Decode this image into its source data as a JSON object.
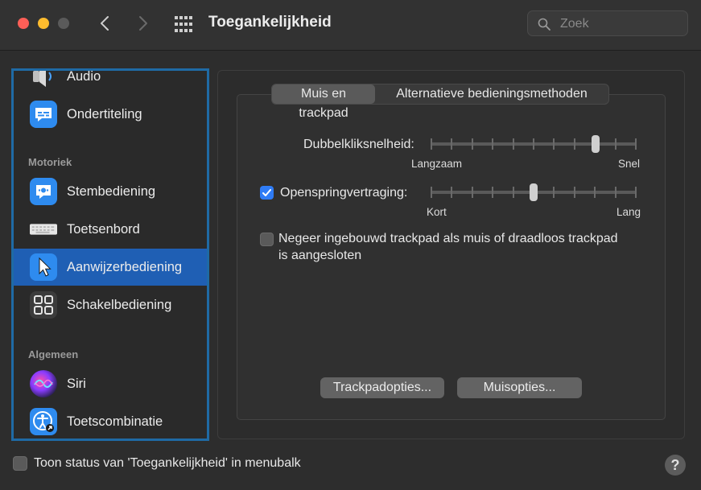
{
  "window": {
    "title": "Toegankelijkheid"
  },
  "search": {
    "placeholder": "Zoek",
    "value": ""
  },
  "sidebar": {
    "items": [
      {
        "label": "Audio",
        "icon": "audio-icon"
      },
      {
        "label": "Ondertiteling",
        "icon": "captions-icon"
      },
      {
        "label": "Stembediening",
        "icon": "voice-control-icon"
      },
      {
        "label": "Toetsenbord",
        "icon": "keyboard-icon"
      },
      {
        "label": "Aanwijzerbediening",
        "icon": "pointer-icon",
        "selected": true
      },
      {
        "label": "Schakelbediening",
        "icon": "switch-control-icon"
      },
      {
        "label": "Siri",
        "icon": "siri-icon"
      },
      {
        "label": "Toetscombinatie",
        "icon": "accessibility-shortcut-icon"
      }
    ],
    "sections": {
      "motor": "Motoriek",
      "general": "Algemeen"
    }
  },
  "tabs": {
    "tab1": "Muis en trackpad",
    "tab2": "Alternatieve bedieningsmethoden",
    "active": "Muis en trackpad"
  },
  "settings": {
    "double_click": {
      "label": "Dubbelkliksnelheid:",
      "min_label": "Langzaam",
      "max_label": "Snel",
      "position": 0.8
    },
    "spring_loading": {
      "label": "Openspringvertraging:",
      "checked": true,
      "min_label": "Kort",
      "max_label": "Lang",
      "position": 0.5
    },
    "ignore_trackpad": {
      "label_line1": "Negeer ingebouwd trackpad als muis of draadloos trackpad",
      "label_line2": "is aangesloten",
      "checked": false
    }
  },
  "buttons": {
    "trackpad_options": "Trackpadopties...",
    "mouse_options": "Muisopties..."
  },
  "footer": {
    "show_status_label": "Toon status van 'Toegankelijkheid' in menubalk",
    "checked": false,
    "help": "?"
  },
  "colors": {
    "accent": "#1f5fb4",
    "checkbox_on": "#2f7cf6"
  }
}
